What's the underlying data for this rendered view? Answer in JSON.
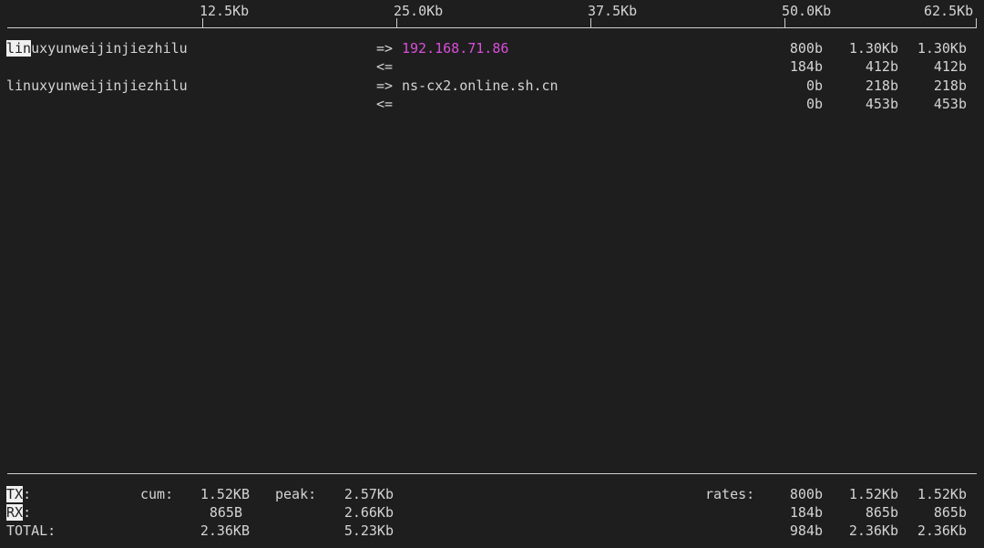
{
  "scale": {
    "ticks": [
      "12.5Kb",
      "25.0Kb",
      "37.5Kb",
      "50.0Kb",
      "62.5Kb"
    ]
  },
  "connections": [
    {
      "host_highlight": "lin",
      "host_rest": "uxyunweijinjiezhilu",
      "tx_dir": "=>",
      "remote": "192.168.71.86",
      "rx_dir": "<=",
      "tx_rates": [
        "800b",
        "1.30Kb",
        "1.30Kb"
      ],
      "rx_rates": [
        "184b",
        "412b",
        "412b"
      ]
    },
    {
      "host": "linuxyunweijinjiezhilu",
      "tx_dir": "=>",
      "remote": "ns-cx2.online.sh.cn",
      "rx_dir": "<=",
      "tx_rates": [
        "0b",
        "218b",
        "218b"
      ],
      "rx_rates": [
        "0b",
        "453b",
        "453b"
      ]
    }
  ],
  "totals": {
    "tx": {
      "label_hl": "TX",
      "label_rest": ":",
      "cum_label": "cum:",
      "cum": "1.52KB",
      "peak_label": "peak:",
      "peak": "2.57Kb",
      "rates_label": "rates:",
      "rates": [
        "800b",
        "1.52Kb",
        "1.52Kb"
      ]
    },
    "rx": {
      "label_hl": "RX",
      "label_rest": ":",
      "cum": "865B",
      "peak": "2.66Kb",
      "rates": [
        "184b",
        "865b",
        "865b"
      ]
    },
    "total": {
      "label": "TOTAL:",
      "cum": "2.36KB",
      "peak": "5.23Kb",
      "rates": [
        "984b",
        "2.36Kb",
        "2.36Kb"
      ]
    }
  },
  "colors": {
    "background": "#1e1e1e",
    "text": "#d4d4d4",
    "remote_highlight": "#d94fd9"
  }
}
